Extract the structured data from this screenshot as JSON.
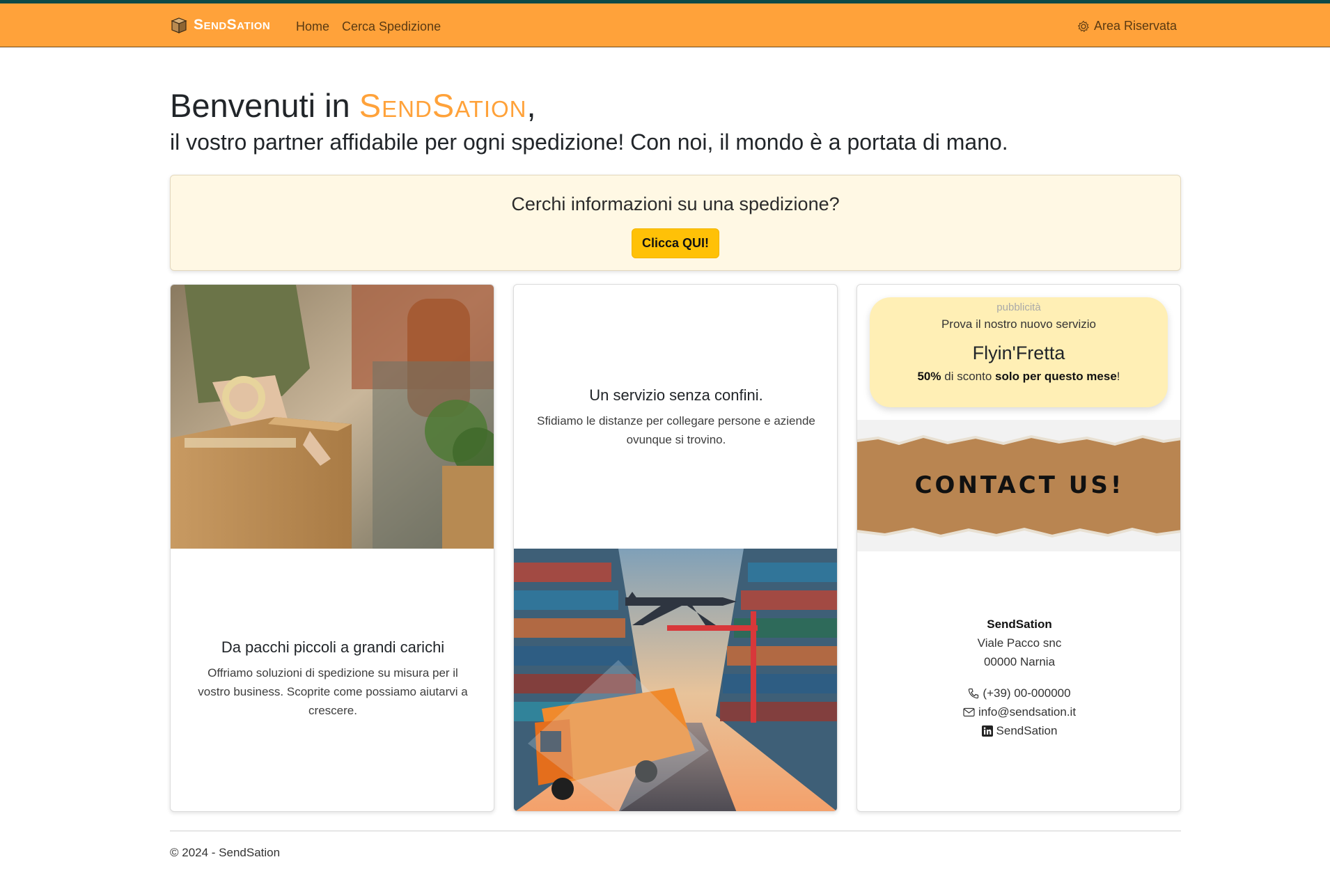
{
  "nav": {
    "brand": "SendSation",
    "home": "Home",
    "cerca": "Cerca Spedizione",
    "area": "Area Riservata"
  },
  "hero": {
    "title_prefix": "Benvenuti in",
    "title_brand": "SendSation",
    "title_suffix": ",",
    "subtitle": "il vostro partner affidabile per ogni spedizione! Con noi, il mondo è a portata di mano."
  },
  "infobox": {
    "question": "Cerchi informazioni su una spedizione?",
    "button": "Clicca QUI!"
  },
  "cards": {
    "c1": {
      "title": "Da pacchi piccoli a grandi carichi",
      "text": "Offriamo soluzioni di spedizione su misura per il vostro business. Scoprite come possiamo aiutarvi a crescere."
    },
    "c2": {
      "title": "Un servizio senza confini.",
      "text": "Sfidiamo le distanze per collegare persone e aziende ovunque si trovino."
    },
    "c3": {
      "ad_label": "pubblicità",
      "ad_line": "Prova il nostro nuovo servizio",
      "ad_name": "Flyin'Fretta",
      "ad_pct": "50%",
      "ad_mid": "di sconto",
      "ad_bold": "solo per questo mese",
      "ad_end": "!",
      "image_text": "CONTACT US!",
      "company": "SendSation",
      "street": "Viale Pacco snc",
      "city": "00000 Narnia",
      "phone": "(+39) 00-000000",
      "email": "info@sendsation.it",
      "linkedin": "SendSation"
    }
  },
  "footer": {
    "text": "© 2024 - SendSation"
  },
  "colors": {
    "accent": "#ffa23a",
    "cta": "#ffc107",
    "infobox_bg": "#fff8e4",
    "ad_bg": "#ffefb5"
  }
}
